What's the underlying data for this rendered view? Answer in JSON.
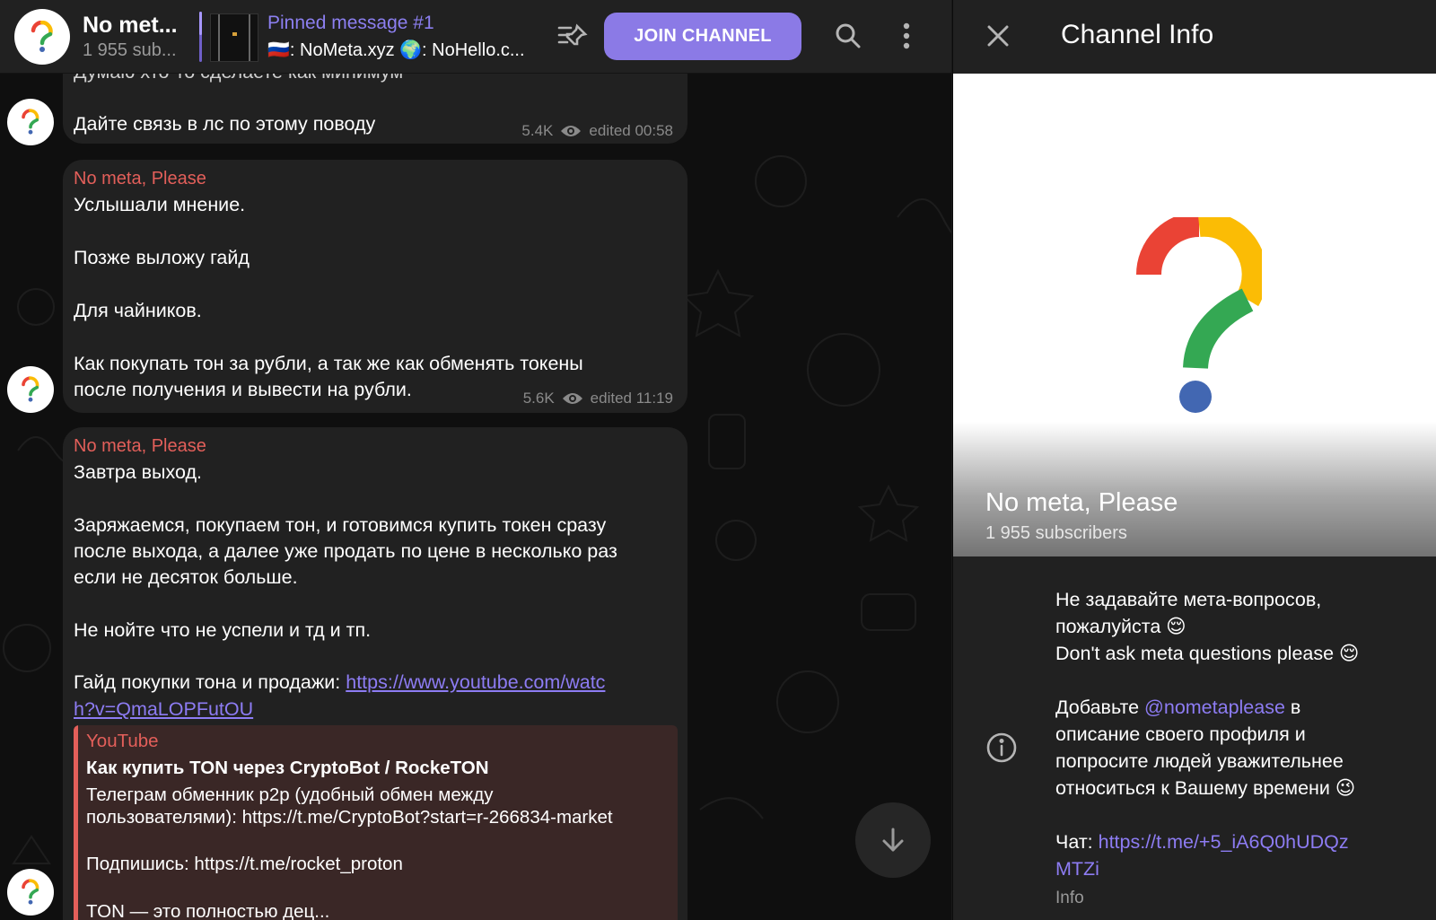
{
  "header": {
    "title": "No meta, Please",
    "title_short": "No met...",
    "subtitle": "1 955 sub...",
    "pinned_title": "Pinned message #1",
    "pinned_text": "🇷🇺: NoMeta.xyz 🌍: NoHello.c...",
    "join_label": "JOIN CHANNEL"
  },
  "messages": [
    {
      "partial_top": "Думаю хто-то сделаете как минимум",
      "lines": [
        "Дайте связь в лс по этому поводу"
      ],
      "views": "5.4K",
      "edited": "edited 00:58"
    },
    {
      "sender": "No meta, Please",
      "lines": [
        "Услышали мнение.",
        "Позже выложу гайд",
        "Для чайников.",
        "Как покупать тон за рубли, а так же как обменять токены",
        "после получения и вывести на рубли."
      ],
      "views": "5.6K",
      "edited": "edited 11:19"
    },
    {
      "sender": "No meta, Please",
      "lines": [
        "Завтра выход.",
        "Заряжаемся, покупаем тон, и готовимся купить токен сразу",
        "после выхода, а далее уже продать по цене в несколько раз",
        "если не десяток больше.",
        "Не нойте что не успели и тд и тп.",
        "Гайд покупки тона и продажи:"
      ],
      "link_part1": "https://www.youtube.com/watc",
      "link_part2": "h?v=QmaLOPFutOU",
      "preview": {
        "site": "YouTube",
        "title": "Как купить TON через CryptoBot / RockeTON",
        "desc1": "Телеграм обменник p2p (удобный обмен между",
        "desc2": "пользователями): https://t.me/CryptoBot?start=r-266834-market",
        "desc3": "Подпишись: https://t.me/rocket_proton",
        "desc4": "TON — это полностью дец..."
      }
    }
  ],
  "info": {
    "title": "Channel Info",
    "name": "No meta, Please",
    "subscribers": "1 955 subscribers",
    "desc_lines": [
      "Не задавайте мета-вопросов,",
      "пожалуйста 😌",
      "Don't ask meta questions please 😌"
    ],
    "add_prefix": "Добавьте ",
    "add_link": "@nometaplease",
    "add_suffix": " в",
    "add_lines": [
      "описание своего профиля и",
      "попросите людей уважительнее",
      "относиться к Вашему времени 😉"
    ],
    "chat_prefix": "Чат: ",
    "chat_link1": "https://t.me/+5_iA6Q0hUDQz",
    "chat_link2": "MTZi",
    "label": "Info"
  },
  "colors": {
    "accent": "#8b7ae6",
    "sender": "#e35f5a",
    "link": "#8d7cf3",
    "bubble": "#212121"
  },
  "icons": [
    "question-logo-icon",
    "unpin-icon",
    "search-icon",
    "more-vert-icon",
    "eye-icon",
    "arrow-down-icon",
    "close-icon",
    "info-circle-icon"
  ]
}
